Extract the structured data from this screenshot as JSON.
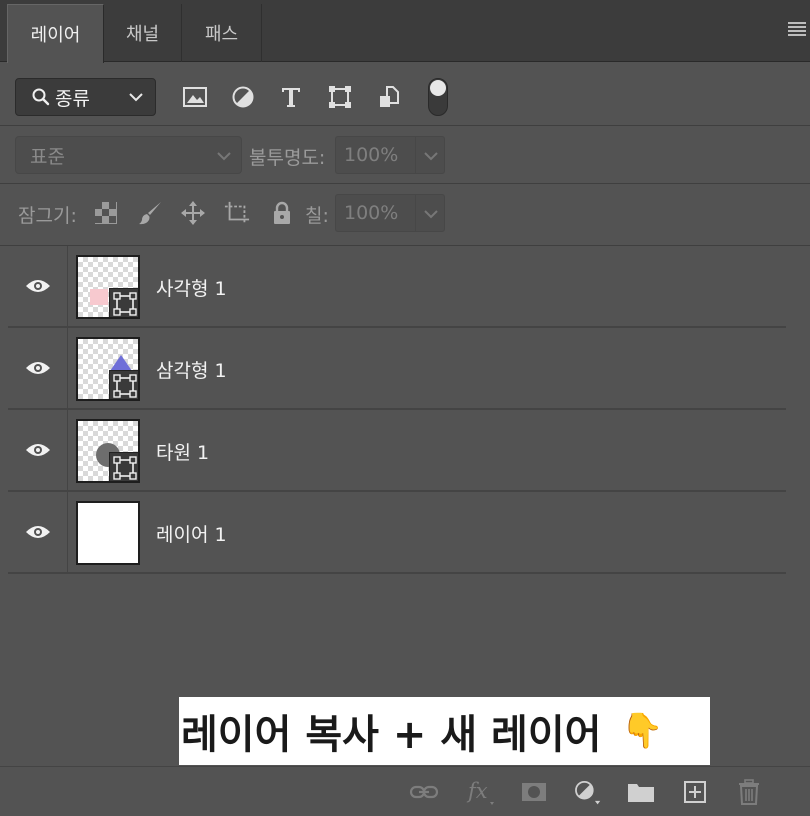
{
  "tabs": [
    {
      "label": "레이어",
      "active": true
    },
    {
      "label": "채널",
      "active": false
    },
    {
      "label": "패스",
      "active": false
    }
  ],
  "filter": {
    "kind_label": "종류",
    "icons": [
      "image-filter-icon",
      "adjustment-filter-icon",
      "type-filter-icon",
      "shape-filter-icon",
      "smart-object-filter-icon"
    ]
  },
  "blend": {
    "mode": "표준",
    "opacity_label": "불투명도:",
    "opacity_value": "100%"
  },
  "lock": {
    "label": "잠그기:",
    "fill_label": "칠:",
    "fill_value": "100%"
  },
  "layers": [
    {
      "name": "사각형 1",
      "type": "shape",
      "shape": "rectangle",
      "color": "#f7c9cf"
    },
    {
      "name": "삼각형 1",
      "type": "shape",
      "shape": "triangle",
      "color": "#6f6fd8"
    },
    {
      "name": "타원 1",
      "type": "shape",
      "shape": "ellipse",
      "color": "#6d6d6d"
    },
    {
      "name": "레이어 1",
      "type": "pixel",
      "color": "#ffffff"
    }
  ],
  "caption": {
    "text": "레이어 복사 + 새 레이어",
    "emoji": "👇"
  },
  "bottom_toolbar": [
    "link-layers-icon",
    "fx-icon",
    "add-mask-icon",
    "adjustment-layer-icon",
    "new-group-icon",
    "new-layer-icon",
    "delete-layer-icon"
  ],
  "colors": {
    "panel_bg": "#535353",
    "tab_bar_bg": "#3c3c3c"
  }
}
